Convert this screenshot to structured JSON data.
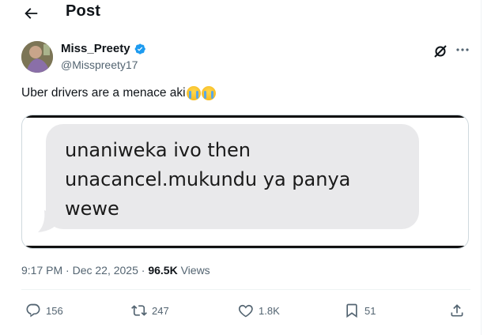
{
  "header": {
    "title": "Post",
    "back_icon": "arrow-left-icon"
  },
  "author": {
    "display_name": "Miss_Preety",
    "handle": "@Misspreety17",
    "verified": true,
    "verified_color": "#1d9bf0"
  },
  "tweet": {
    "text": "Uber drivers are a menace aki",
    "emojis": [
      "loudly-crying-face",
      "loudly-crying-face"
    ],
    "image_text": "unaniweka ivo then\nunacancel.mukundu ya panya\nwewe"
  },
  "meta": {
    "time": "9:17 PM",
    "separator": "·",
    "date": "Dec 22, 2025",
    "views_count": "96.5K",
    "views_label": "Views"
  },
  "actions": {
    "replies": "156",
    "reposts": "247",
    "likes": "1.8K",
    "bookmarks": "51"
  }
}
